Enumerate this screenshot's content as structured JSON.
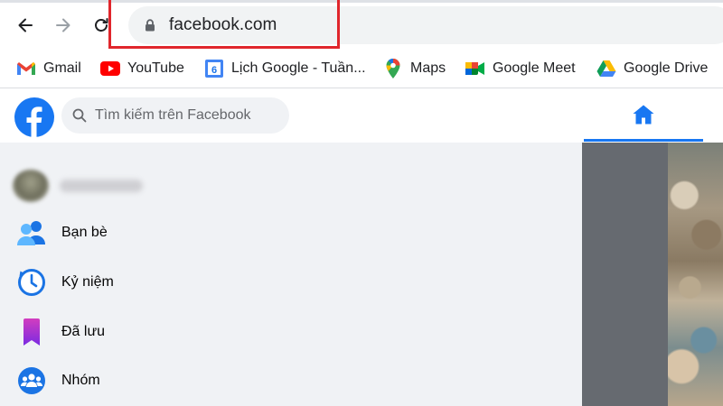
{
  "browser": {
    "url": "facebook.com"
  },
  "bookmarks": [
    {
      "label": "Gmail",
      "icon": "gmail-icon"
    },
    {
      "label": "YouTube",
      "icon": "youtube-icon"
    },
    {
      "label": "Lịch Google - Tuần...",
      "icon": "google-calendar-icon",
      "icon_text": "6"
    },
    {
      "label": "Maps",
      "icon": "google-maps-icon"
    },
    {
      "label": "Google Meet",
      "icon": "google-meet-icon"
    },
    {
      "label": "Google Drive",
      "icon": "google-drive-icon"
    }
  ],
  "facebook": {
    "search_placeholder": "Tìm kiếm trên Facebook",
    "menu": [
      {
        "label": "Bạn bè",
        "icon": "friends-icon"
      },
      {
        "label": "Kỷ niệm",
        "icon": "memories-icon"
      },
      {
        "label": "Đã lưu",
        "icon": "saved-icon"
      },
      {
        "label": "Nhóm",
        "icon": "groups-icon"
      }
    ]
  },
  "colors": {
    "facebook_blue": "#1877f2",
    "highlight_red": "#e0262c",
    "sidebar_bg": "#f0f2f5"
  }
}
